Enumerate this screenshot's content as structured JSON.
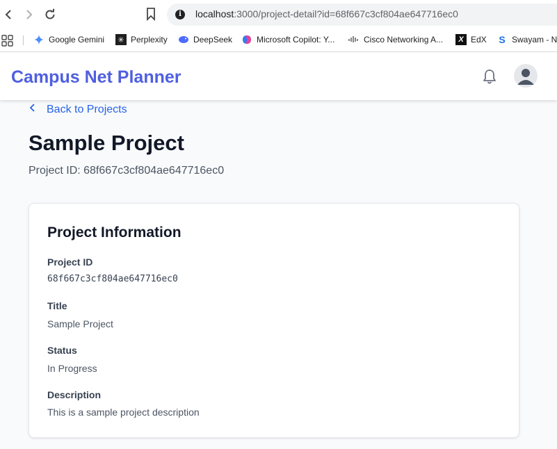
{
  "browser": {
    "url_host": "localhost",
    "url_rest": ":3000/project-detail?id=68f667c3cf804ae647716ec0",
    "bookmarks": [
      {
        "label": "Google Gemini",
        "icon": "gemini-icon"
      },
      {
        "label": "Perplexity",
        "icon": "perplexity-icon"
      },
      {
        "label": "DeepSeek",
        "icon": "deepseek-icon"
      },
      {
        "label": "Microsoft Copilot: Y...",
        "icon": "copilot-icon"
      },
      {
        "label": "Cisco Networking A...",
        "icon": "cisco-icon"
      },
      {
        "label": "EdX",
        "icon": "edx-icon"
      },
      {
        "label": "Swayam - Ni",
        "icon": "swayam-icon"
      }
    ]
  },
  "header": {
    "brand": "Campus Net Planner"
  },
  "main": {
    "back_label": "Back to Projects",
    "title": "Sample Project",
    "project_id_line": "Project ID: 68f667c3cf804ae647716ec0"
  },
  "card": {
    "title": "Project Information",
    "fields": [
      {
        "label": "Project ID",
        "value": "68f667c3cf804ae647716ec0"
      },
      {
        "label": "Title",
        "value": "Sample Project"
      },
      {
        "label": "Status",
        "value": "In Progress"
      },
      {
        "label": "Description",
        "value": "This is a sample project description"
      }
    ]
  },
  "colors": {
    "brand": "#4f5fe0",
    "link": "#2563eb",
    "background": "#f9fafb"
  }
}
